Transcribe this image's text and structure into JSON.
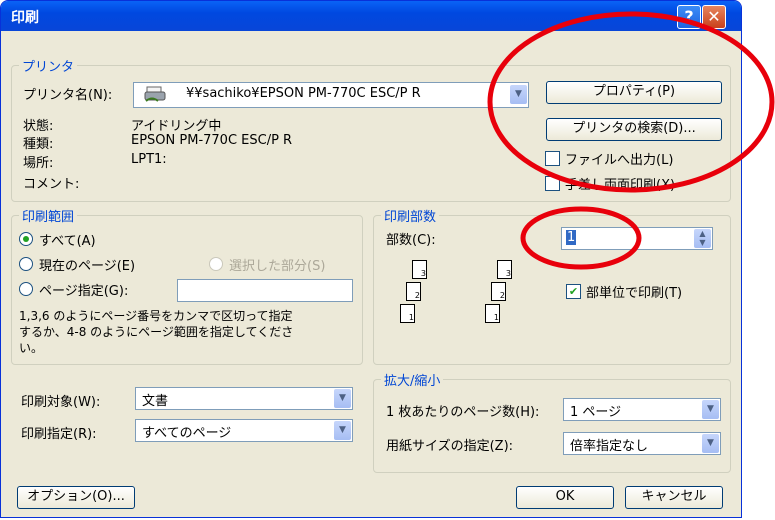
{
  "title": "印刷",
  "printer": {
    "legend": "プリンタ",
    "name_label": "プリンタ名(N):",
    "name_value": "¥¥sachiko¥EPSON PM-770C ESC/P R",
    "properties_btn": "プロパティ(P)",
    "find_btn": "プリンタの検索(D)...",
    "status_label": "状態:",
    "status_value": "アイドリング中",
    "type_label": "種類:",
    "type_value": "EPSON PM-770C ESC/P R",
    "where_label": "場所:",
    "where_value": "LPT1:",
    "comment_label": "コメント:",
    "print_to_file": "ファイルへ出力(L)",
    "manual_duplex": "手差し両面印刷(X)"
  },
  "range": {
    "legend": "印刷範囲",
    "all": "すべて(A)",
    "current": "現在のページ(E)",
    "selection": "選択した部分(S)",
    "pages": "ページ指定(G):",
    "hint_line1": "1,3,6 のようにページ番号をカンマで区切って指定",
    "hint_line2": "するか、4-8 のようにページ範囲を指定してくださ",
    "hint_line3": "い。"
  },
  "copies": {
    "legend": "印刷部数",
    "count_label": "部数(C):",
    "count_value": "1",
    "collate": "部単位で印刷(T)",
    "page_nums": [
      "1",
      "2",
      "3"
    ]
  },
  "print_what": {
    "label": "印刷対象(W):",
    "value": "文書"
  },
  "print_select": {
    "label": "印刷指定(R):",
    "value": "すべてのページ"
  },
  "zoom": {
    "legend": "拡大/縮小",
    "pages_per_sheet_label": "1 枚あたりのページ数(H):",
    "pages_per_sheet_value": "1 ページ",
    "scale_label": "用紙サイズの指定(Z):",
    "scale_value": "倍率指定なし"
  },
  "buttons": {
    "options": "オプション(O)...",
    "ok": "OK",
    "cancel": "キャンセル"
  },
  "colors": {
    "annotation": "#e8000b",
    "titlebar": "#0a5ce8",
    "legend_text": "#0046d5"
  },
  "icons": [
    "help-icon",
    "close-icon",
    "printer-icon",
    "chevron-down-icon",
    "spinner-icon"
  ]
}
